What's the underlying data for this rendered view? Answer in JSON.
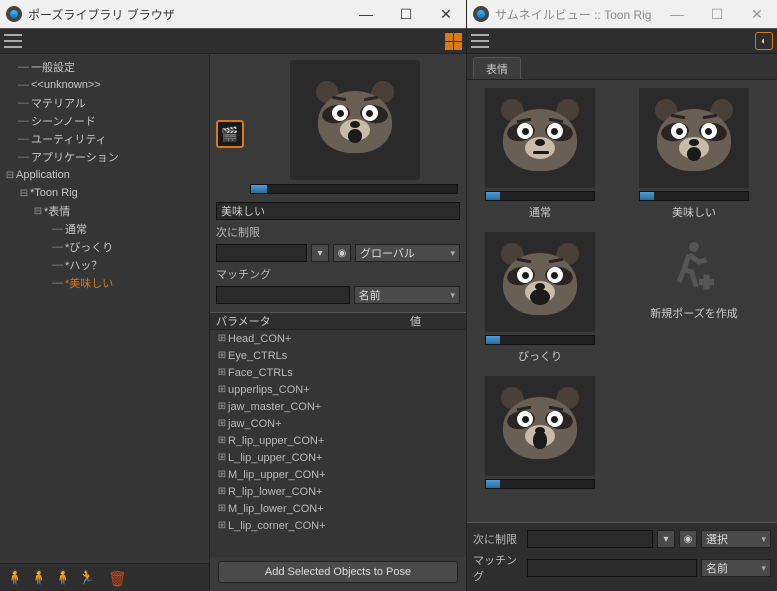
{
  "left_window": {
    "title": "ポーズライブラリ ブラウザ",
    "tree": {
      "items": [
        {
          "label": "一般設定",
          "depth": 0
        },
        {
          "label": "<<unknown>>",
          "depth": 0
        },
        {
          "label": "マテリアル",
          "depth": 0
        },
        {
          "label": "シーンノード",
          "depth": 0
        },
        {
          "label": "ユーティリティ",
          "depth": 0
        },
        {
          "label": "アプリケーション",
          "depth": 0
        }
      ],
      "app": {
        "label": "Application",
        "rig": {
          "label": "*Toon Rig",
          "group": {
            "label": "*表情",
            "poses": [
              {
                "label": "通常"
              },
              {
                "label": "*びっくり"
              },
              {
                "label": "*ハッ？"
              },
              {
                "label": "*美味しい"
              }
            ]
          }
        }
      }
    }
  },
  "props": {
    "name_value": "美味しい",
    "limit_label": "次に制限",
    "limit_dropdown": "グローバル",
    "matching_label": "マッチング",
    "matching_dropdown": "名前",
    "param_header": {
      "col1": "パラメータ",
      "col2": "値"
    },
    "params": [
      "Head_CON+",
      "Eye_CTRLs",
      "Face_CTRLs",
      "upperlips_CON+",
      "jaw_master_CON+",
      "jaw_CON+",
      "R_lip_upper_CON+",
      "L_lip_upper_CON+",
      "M_lip_upper_CON+",
      "R_lip_lower_CON+",
      "M_lip_lower_CON+",
      "L_lip_corner_CON+"
    ],
    "add_button": "Add Selected Objects to Pose"
  },
  "right_window": {
    "title": "サムネイルビュー :: Toon Rig",
    "tab": "表情",
    "poses": [
      {
        "label": "通常"
      },
      {
        "label": "美味しい"
      },
      {
        "label": "びっくり"
      }
    ],
    "new_pose": "新規ポーズを作成",
    "bottom": {
      "limit_label": "次に制限",
      "select_dropdown": "選択",
      "matching_label": "マッチング",
      "matching_dropdown": "名前"
    }
  }
}
